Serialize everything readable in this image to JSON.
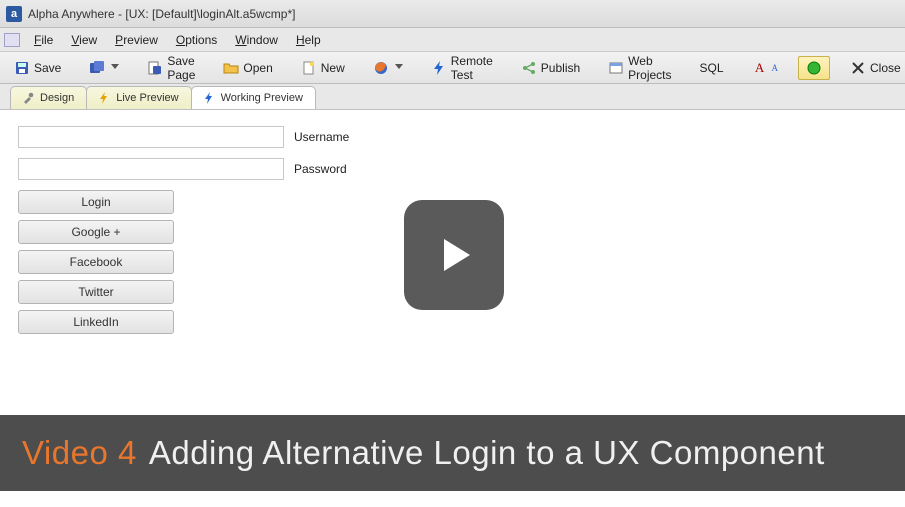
{
  "title": "Alpha Anywhere - [UX: [Default]\\loginAlt.a5wcmp*]",
  "app_icon_letter": "a",
  "menu": {
    "file": "File",
    "view": "View",
    "preview": "Preview",
    "options": "Options",
    "window": "Window",
    "help": "Help"
  },
  "toolbar": {
    "save": "Save",
    "save_page": "Save Page",
    "open": "Open",
    "new": "New",
    "remote_test": "Remote Test",
    "publish": "Publish",
    "web_projects": "Web Projects",
    "sql": "SQL",
    "close": "Close"
  },
  "tabs": {
    "design": "Design",
    "live_preview": "Live Preview",
    "working_preview": "Working Preview"
  },
  "form": {
    "username_label": "Username",
    "password_label": "Password",
    "username_value": "",
    "password_value": "",
    "buttons": {
      "login": "Login",
      "google": "Google +",
      "facebook": "Facebook",
      "twitter": "Twitter",
      "linkedin": "LinkedIn"
    }
  },
  "caption": {
    "prefix": "Video 4",
    "text": "Adding Alternative Login to a UX Component"
  }
}
